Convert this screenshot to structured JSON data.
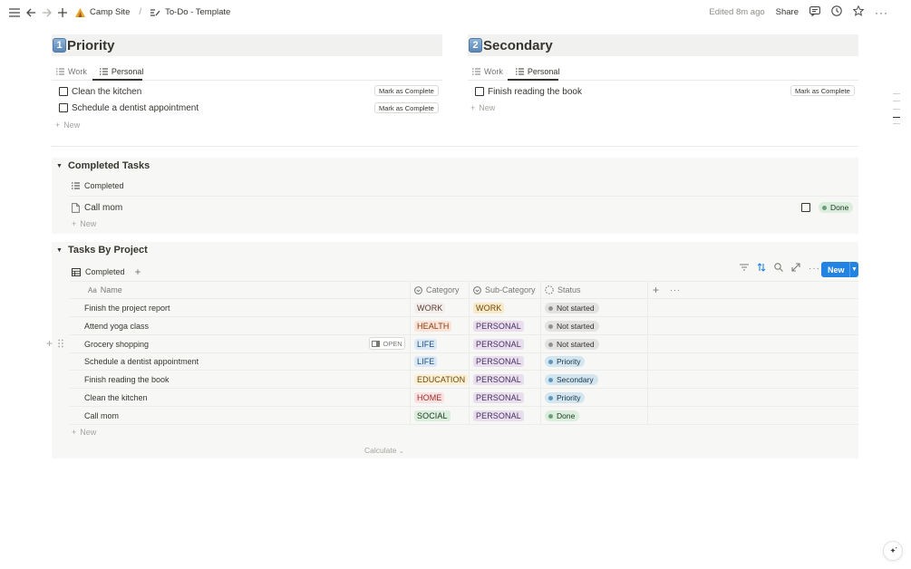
{
  "topbar": {
    "breadcrumb": [
      "Camp Site",
      "To-Do - Template"
    ],
    "edited": "Edited 8m ago",
    "share": "Share"
  },
  "priority": {
    "number": "1",
    "title": "Priority",
    "tabs": [
      "Work",
      "Personal"
    ],
    "tasks": [
      "Clean the kitchen",
      "Schedule a dentist appointment"
    ],
    "button": "Mark as Complete",
    "new": "New"
  },
  "secondary": {
    "number": "2",
    "title": "Secondary",
    "tabs": [
      "Work",
      "Personal"
    ],
    "tasks": [
      "Finish reading the book"
    ],
    "button": "Mark as Complete",
    "new": "New"
  },
  "completed_section": {
    "title": "Completed Tasks",
    "view": "Completed",
    "items": [
      {
        "name": "Call mom",
        "status": "Done"
      }
    ],
    "new": "New"
  },
  "project_section": {
    "title": "Tasks By Project",
    "view": "Completed",
    "new_button": "New",
    "columns": [
      "Name",
      "Category",
      "Sub-Category",
      "Status"
    ],
    "rows": [
      {
        "name": "Finish the project report",
        "category": "WORK",
        "sub": "WORK",
        "status": "Not started"
      },
      {
        "name": "Attend yoga class",
        "category": "HEALTH",
        "sub": "PERSONAL",
        "status": "Not started"
      },
      {
        "name": "Grocery shopping",
        "category": "LIFE",
        "sub": "PERSONAL",
        "status": "Not started"
      },
      {
        "name": "Schedule a dentist appointment",
        "category": "LIFE",
        "sub": "PERSONAL",
        "status": "Priority"
      },
      {
        "name": "Finish reading the book",
        "category": "EDUCATION",
        "sub": "PERSONAL",
        "status": "Secondary"
      },
      {
        "name": "Clean the kitchen",
        "category": "HOME",
        "sub": "PERSONAL",
        "status": "Priority"
      },
      {
        "name": "Call mom",
        "category": "SOCIAL",
        "sub": "PERSONAL",
        "status": "Done"
      }
    ],
    "open_label": "OPEN",
    "new": "New",
    "calculate": "Calculate"
  },
  "colors": {
    "accent": "#2383e2",
    "heading_bg": "#f1f1ef",
    "section_bg": "#f7f7f5"
  }
}
